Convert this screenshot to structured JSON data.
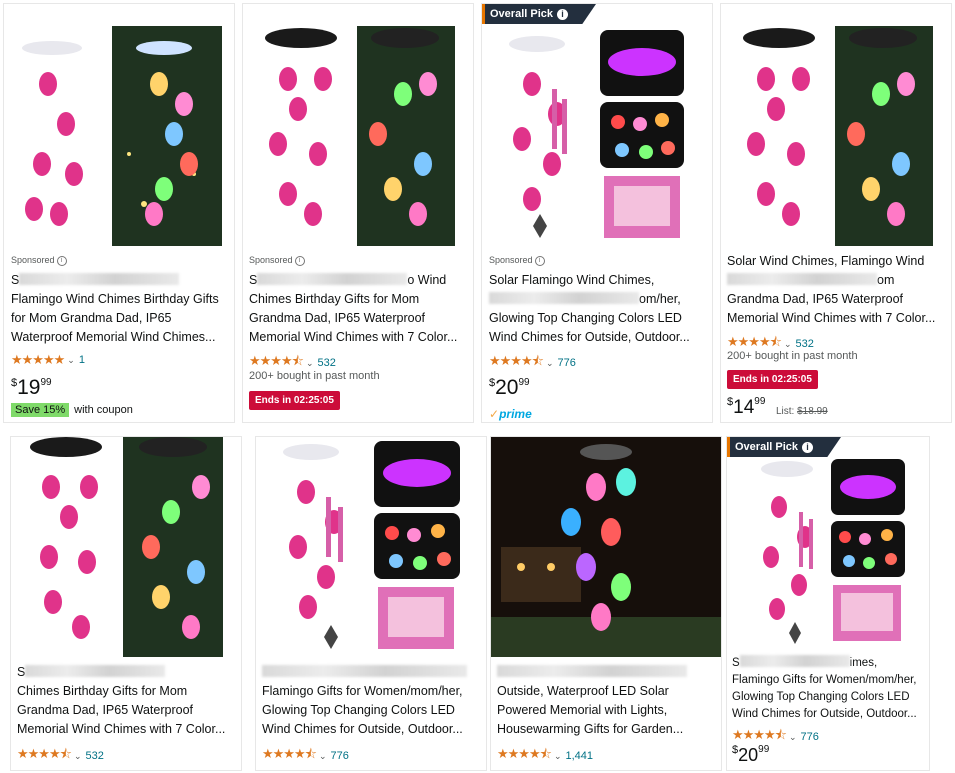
{
  "icons": {
    "info": "info-icon",
    "chevron": "chevron-down-icon",
    "star": "star-icon",
    "check": "prime-check-icon"
  },
  "colors": {
    "star": "#de7921",
    "link": "#007185",
    "deal": "#cc0c39",
    "coupon": "#7fda69",
    "badge": "#232f3e",
    "prime": "#00a8e1"
  },
  "cards": [
    {
      "sponsored": "Sponsored",
      "title_lines": [
        "S",
        "Flamingo Wind Chimes Birthday Gifts",
        "for Mom Grandma Dad, IP65",
        "Waterproof Memorial Wind Chimes..."
      ],
      "stars": "★★★★★",
      "rating": "5.0",
      "reviews": "1",
      "price_symbol": "$",
      "price_whole": "19",
      "price_fraction": "99",
      "coupon_save": "Save 15%",
      "coupon_text": "with coupon"
    },
    {
      "sponsored": "Sponsored",
      "title_lines": [
        "S",
        "o Wind",
        "Chimes Birthday Gifts for Mom",
        "Grandma Dad, IP65 Waterproof",
        "Memorial Wind Chimes with 7 Color..."
      ],
      "stars": "★★★★⯪",
      "rating": "4.5",
      "reviews": "532",
      "bought": "200+ bought in past month",
      "deal": "Ends in 02:25:05"
    },
    {
      "badge": "Overall Pick",
      "sponsored": "Sponsored",
      "title_lines": [
        "Solar Flamingo Wind Chimes,",
        "om/her,",
        "Glowing Top Changing Colors LED",
        "Wind Chimes for Outside, Outdoor..."
      ],
      "stars": "★★★★⯪",
      "rating": "4.5",
      "reviews": "776",
      "price_symbol": "$",
      "price_whole": "20",
      "price_fraction": "99",
      "prime": "prime"
    },
    {
      "title_lines": [
        "Solar Wind Chimes, Flamingo Wind",
        "om",
        "Grandma Dad, IP65 Waterproof",
        "Memorial Wind Chimes with 7 Color..."
      ],
      "stars": "★★★★⯪",
      "rating": "4.5",
      "reviews": "532",
      "bought": "200+ bought in past month",
      "deal": "Ends in 02:25:05",
      "price_symbol": "$",
      "price_whole": "14",
      "price_fraction": "99",
      "list_label": "List:",
      "list_price": "$18.99"
    },
    {
      "title_lines": [
        "S",
        "Chimes Birthday Gifts for Mom",
        "Grandma Dad, IP65 Waterproof",
        "Memorial Wind Chimes with 7 Color..."
      ],
      "stars": "★★★★⯪",
      "rating": "4.5",
      "reviews": "532"
    },
    {
      "title_lines": [
        "",
        "Flamingo Gifts for Women/mom/her,",
        "Glowing Top Changing Colors LED",
        "Wind Chimes for Outside, Outdoor..."
      ],
      "stars": "★★★★⯪",
      "rating": "4.5",
      "reviews": "776"
    },
    {
      "title_lines": [
        "",
        "Outside, Waterproof LED Solar",
        "Powered Memorial with Lights,",
        "Housewarming Gifts for Garden..."
      ],
      "stars": "★★★★⯪",
      "rating": "4.5",
      "reviews": "1,441"
    },
    {
      "badge": "Overall Pick",
      "title_lines": [
        "S",
        "imes,",
        "Flamingo Gifts for Women/mom/her,",
        "Glowing Top Changing Colors LED",
        "Wind Chimes for Outside, Outdoor..."
      ],
      "stars": "★★★★⯪",
      "rating": "4.5",
      "reviews": "776",
      "price_symbol": "$",
      "price_whole": "20",
      "price_fraction": "99"
    }
  ]
}
